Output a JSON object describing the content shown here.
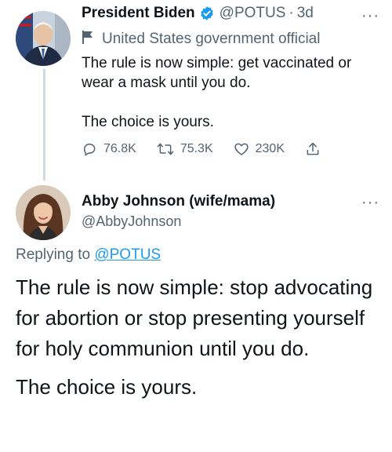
{
  "tweet1": {
    "display_name": "President Biden",
    "handle": "@POTUS",
    "separator": "·",
    "time": "3d",
    "label": "United States government official",
    "text_line1": "The rule is now simple: get vaccinated or wear a mask until you do.",
    "text_line2": "The choice is yours.",
    "stats": {
      "replies": "76.8K",
      "retweets": "75.3K",
      "likes": "230K"
    },
    "verified_color": "#1d9bf0"
  },
  "tweet2": {
    "display_name": "Abby Johnson (wife/mama)",
    "handle": "@AbbyJohnson",
    "replying_prefix": "Replying to",
    "replying_handle": "@POTUS",
    "text_para1": "The rule is now simple: stop advocating for abortion or stop presenting yourself for holy communion until you do.",
    "text_para2": "The choice is yours."
  },
  "more_label": "···",
  "icons": [
    "verified-badge-icon",
    "flag-icon",
    "reply-icon",
    "retweet-icon",
    "like-icon",
    "share-icon",
    "more-icon"
  ],
  "colors": {
    "text": "#0f1419",
    "muted": "#536471",
    "link": "#1d9bf0",
    "thread_line": "#cfd9de"
  }
}
